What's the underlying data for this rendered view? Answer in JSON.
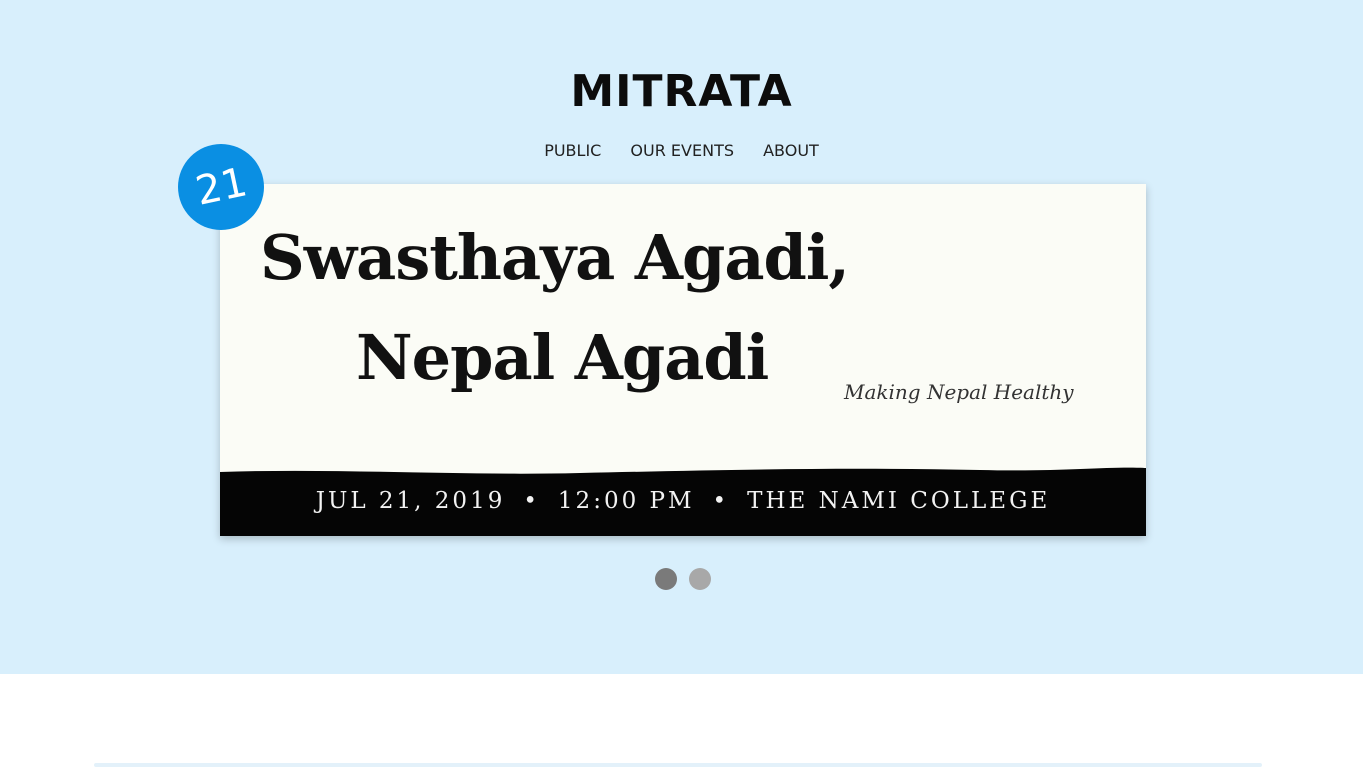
{
  "site": {
    "title": "MITRATA"
  },
  "nav": {
    "items": [
      {
        "label": "PUBLIC"
      },
      {
        "label": "OUR EVENTS"
      },
      {
        "label": "ABOUT"
      }
    ]
  },
  "banner": {
    "headline_line1": "Swasthaya Agadi,",
    "headline_line2": "Nepal Agadi",
    "tagline": "Making Nepal Healthy",
    "date": "JUL 21, 2019",
    "time": "12:00 PM",
    "venue": "THE NAMI COLLEGE",
    "separator": "•",
    "day_badge": "21"
  },
  "carousel": {
    "slide_count": 2,
    "active_index": 0
  },
  "colors": {
    "hero_background": "#d8effc",
    "badge": "#0a8fe3",
    "dot_active": "#7a7a7a",
    "dot_inactive": "#a8a8a8"
  }
}
